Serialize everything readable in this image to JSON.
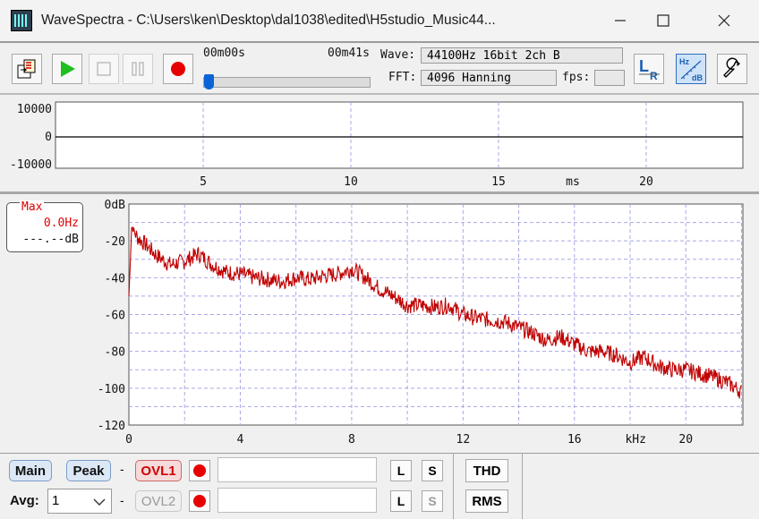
{
  "window": {
    "title": "WaveSpectra - C:\\Users\\ken\\Desktop\\dal1038\\edited\\H5studio_Music44...",
    "minimize": "—",
    "maximize": "☐",
    "close": "✕"
  },
  "toolbar": {
    "time_start": "00m00s",
    "time_end": "00m41s",
    "position_fraction": 0.0,
    "wave_label": "Wave:",
    "wave_value": "44100Hz 16bit 2ch B",
    "fft_label": "FFT:",
    "fft_value": "4096 Hanning",
    "fps_label": "fps:",
    "fps_value": "",
    "icons": [
      "open-file-icon",
      "play-icon",
      "stop-icon",
      "pause-icon",
      "record-icon",
      "lr-channel-icon",
      "hz-db-icon",
      "settings-wrench-icon"
    ]
  },
  "wave_panel": {
    "y_labels": [
      "10000",
      "0",
      "-10000"
    ],
    "x_labels": [
      "5",
      "10",
      "15",
      "ms",
      "20"
    ]
  },
  "spectrum_panel": {
    "max_box": {
      "title": "Max",
      "freq": "0.0Hz",
      "level": "---.--dB"
    },
    "y_labels": [
      "0dB",
      "-20",
      "-40",
      "-60",
      "-80",
      "-100",
      "-120"
    ],
    "x_labels": [
      "0",
      "4",
      "8",
      "12",
      "16",
      "kHz",
      "20"
    ],
    "line_color": "#c00000"
  },
  "bottom": {
    "main_label": "Main",
    "peak_label": "Peak",
    "dash1": "-",
    "ovl1_label": "OVL1",
    "avg_label": "Avg:",
    "avg_value": "1",
    "dash2": "-",
    "ovl2_label": "OVL2",
    "l_label": "L",
    "s_label": "S",
    "thd_label": "THD",
    "rms_label": "RMS"
  },
  "chart_data": {
    "type": "line",
    "xlabel": "kHz",
    "ylabel": "dB",
    "xlim": [
      0,
      22.05
    ],
    "ylim": [
      -120,
      0
    ],
    "series": [
      {
        "x": [
          0,
          0.1,
          0.3,
          0.6,
          1,
          1.5,
          2,
          2.5,
          3,
          3.5,
          4,
          4.5,
          5,
          5.5,
          6,
          6.5,
          7,
          7.5,
          8,
          8.5,
          9,
          9.5,
          10,
          10.5,
          11,
          11.5,
          12,
          12.5,
          13,
          13.5,
          14,
          14.5,
          15,
          15.5,
          16,
          16.5,
          17,
          17.5,
          18,
          18.5,
          19,
          19.5,
          20,
          20.5,
          21,
          21.5,
          22
        ],
        "y": [
          -50,
          -12,
          -18,
          -22,
          -28,
          -33,
          -31,
          -27,
          -33,
          -37,
          -38,
          -40,
          -41,
          -42,
          -40,
          -41,
          -39,
          -38,
          -35,
          -40,
          -46,
          -50,
          -55,
          -55,
          -56,
          -55,
          -60,
          -62,
          -63,
          -64,
          -67,
          -70,
          -74,
          -72,
          -76,
          -80,
          -80,
          -82,
          -86,
          -83,
          -88,
          -90,
          -90,
          -92,
          -94,
          -97,
          -102
        ]
      }
    ]
  }
}
